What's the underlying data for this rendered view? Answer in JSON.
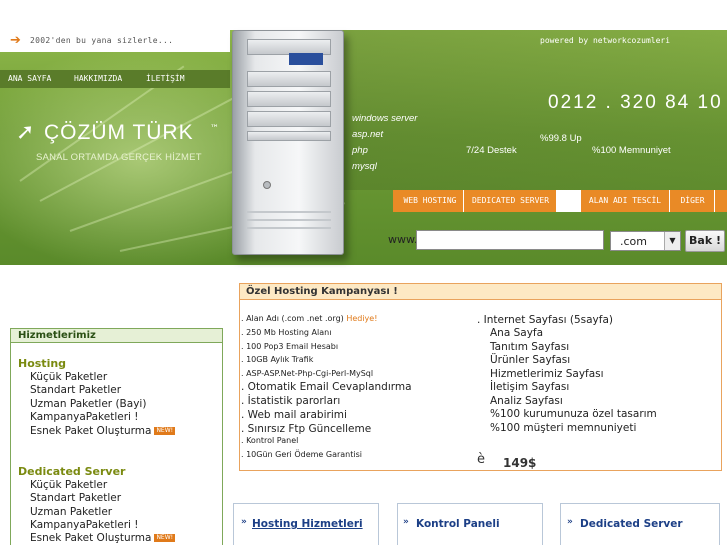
{
  "header": {
    "tagline": "2002'den bu yana sizlerle...",
    "powered_by": "powered by networkcozumleri",
    "nav": [
      "ANA SAYFA",
      "HAKKIMIZDA",
      "İLETİŞİM"
    ],
    "phone": "0212 . 320 84 10",
    "brand": "ÇÖZÜM TÜRK",
    "brand_tm": "™",
    "slogan": "SANAL ORTAMDA GERÇEK HİZMET",
    "features": [
      "windows server",
      "asp.net",
      "php",
      "mysql"
    ],
    "stats": [
      "%99.8 Up",
      "7/24 Destek",
      "%100 Memnuniyet"
    ]
  },
  "tabs": [
    "WEB HOSTING",
    "DEDICATED SERVER",
    "ALAN ADI TESCİL",
    "DİGER"
  ],
  "domain_search": {
    "label": "www.",
    "value": "",
    "tld": ".com",
    "button": "Bak !"
  },
  "campaign": {
    "title": "Özel Hosting Kampanyası !",
    "left_items": [
      ". Alan Adı (.com .net .org) ",
      ". 250 Mb Hosting Alanı",
      ". 100 Pop3 Email Hesabı",
      ". 10GB Aylık Trafik",
      ". ASP-ASP.Net-Php-Cgi-Perl-MySql",
      ". Otomatik Email Cevaplandırma",
      ". İstatistik parorları",
      ". Web mail arabirimi",
      ". Sınırsız Ftp Güncelleme",
      ". Kontrol Panel",
      ". 10Gün Geri Ödeme Garantisi"
    ],
    "gift": "Hediye!",
    "right_title": ". Internet Sayfası (5sayfa)",
    "right_items": [
      "Ana Sayfa",
      "Tanıtım Sayfası",
      "Ürünler Sayfası",
      "Hizmetlerimiz Sayfası",
      "İletişim Sayfası",
      "Analiz Sayfası",
      "%100 kurumunuza özel tasarım",
      "%100 müşteri memnuniyeti"
    ],
    "price_glyph": "è",
    "price": "149$"
  },
  "sidebar": {
    "title": "Hizmetlerimiz",
    "new_badge": "NEW!",
    "hosting_title": "Hosting",
    "hosting_items": [
      "Küçük Paketler",
      "Standart Paketler",
      "Uzman Paketler (Bayi)",
      "KampanyaPaketleri !",
      "Esnek Paket Oluşturma"
    ],
    "dedicated_title": "Dedicated Server",
    "dedicated_items": [
      "Küçük Paketler",
      "Standart Paketler",
      "Uzman Paketler",
      "KampanyaPaketleri !",
      "Esnek Paket Oluşturma"
    ]
  },
  "bottom_boxes": [
    "Hosting Hizmetleri",
    "Kontrol Paneli",
    "Dedicated Server"
  ],
  "colors": {
    "accent": "#e98a26",
    "green": "#6e9b36",
    "link_blue": "#1c3f86"
  }
}
